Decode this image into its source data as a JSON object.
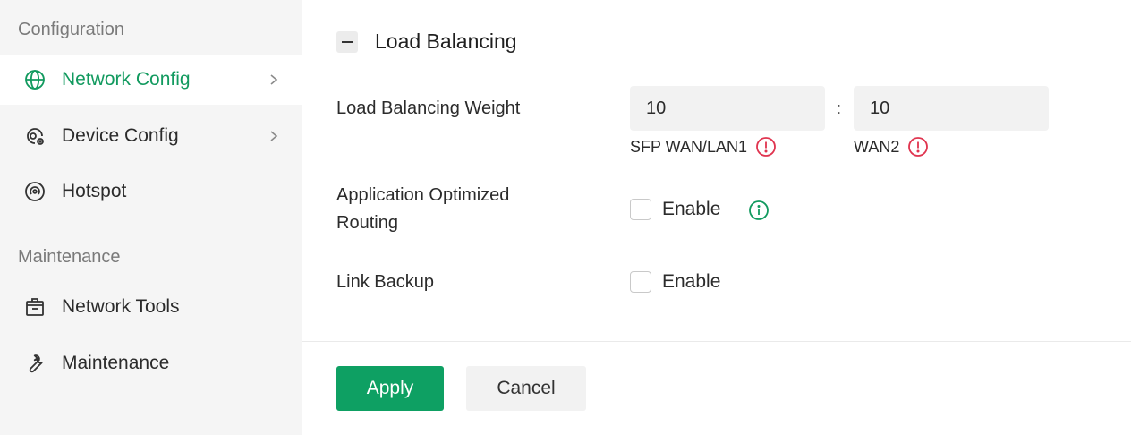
{
  "sidebar": {
    "sections": [
      {
        "title": "Configuration"
      },
      {
        "title": "Maintenance"
      }
    ],
    "items": [
      {
        "label": "Network Config",
        "icon": "globe-icon",
        "active": true,
        "has_submenu": true
      },
      {
        "label": "Device Config",
        "icon": "device-settings-icon",
        "active": false,
        "has_submenu": true
      },
      {
        "label": "Hotspot",
        "icon": "hotspot-icon",
        "active": false,
        "has_submenu": false
      },
      {
        "label": "Network Tools",
        "icon": "toolbox-icon",
        "active": false,
        "has_submenu": false
      },
      {
        "label": "Maintenance",
        "icon": "wrench-icon",
        "active": false,
        "has_submenu": false
      }
    ]
  },
  "main": {
    "section_title": "Load Balancing",
    "weight": {
      "label": "Load Balancing Weight",
      "separator": ":",
      "wan1_value": "10",
      "wan2_value": "10",
      "wan1_label": "SFP WAN/LAN1",
      "wan2_label": "WAN2"
    },
    "app_routing": {
      "label_line1": "Application Optimized",
      "label_line2": "Routing",
      "checkbox_label": "Enable",
      "checked": false
    },
    "link_backup": {
      "label": "Link Backup",
      "checkbox_label": "Enable",
      "checked": false
    },
    "actions": {
      "apply_label": "Apply",
      "cancel_label": "Cancel"
    }
  },
  "colors": {
    "accent": "#129a5f",
    "primary_button": "#0ea063",
    "warning": "#e0344f",
    "sidebar_bg": "#f5f5f5",
    "input_bg": "#f2f2f2"
  }
}
